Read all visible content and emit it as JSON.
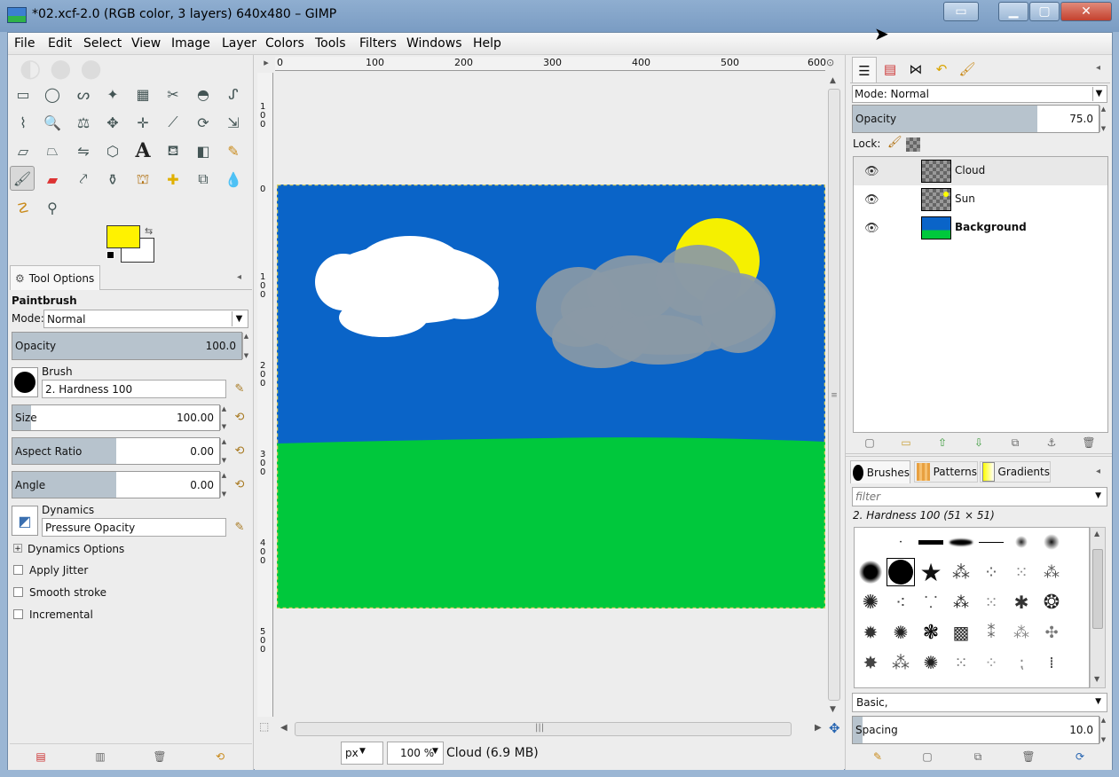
{
  "window": {
    "title": "*02.xcf-2.0 (RGB color, 3 layers) 640x480 – GIMP",
    "minimize_icon": "minimize-icon",
    "maximize_icon": "maximize-icon",
    "close_icon": "close-icon"
  },
  "menu": [
    "File",
    "Edit",
    "Select",
    "View",
    "Image",
    "Layer",
    "Colors",
    "Tools",
    "Filters",
    "Windows",
    "Help"
  ],
  "toolbox": {
    "colors": {
      "foreground": "#fff200",
      "background": "#ffffff"
    }
  },
  "tool_options": {
    "tab_label": "Tool Options",
    "tool_name": "Paintbrush",
    "mode_label": "Mode:",
    "mode_value": "Normal",
    "opacity_label": "Opacity",
    "opacity_value": "100.0",
    "brush_label": "Brush",
    "brush_value": "2. Hardness 100",
    "size_label": "Size",
    "size_value": "100.00",
    "aspect_label": "Aspect Ratio",
    "aspect_value": "0.00",
    "angle_label": "Angle",
    "angle_value": "0.00",
    "dynamics_label": "Dynamics",
    "dynamics_value": "Pressure Opacity",
    "dynamics_options_label": "Dynamics Options",
    "apply_jitter_label": "Apply Jitter",
    "smooth_stroke_label": "Smooth stroke",
    "incremental_label": "Incremental"
  },
  "canvas": {
    "ruler_top_labels": [
      "0",
      "100",
      "200",
      "300",
      "400",
      "500",
      "600"
    ],
    "ruler_left_labels": [
      "100",
      "0",
      "100",
      "200",
      "300",
      "400",
      "500"
    ],
    "sky_color": "#0a64c8",
    "grass_color": "#00c83c",
    "unit_value": "px",
    "zoom_value": "100 %",
    "status_text": "Cloud (6.9 MB)"
  },
  "layers_panel": {
    "mode_label": "Mode: Normal",
    "opacity_label": "Opacity",
    "opacity_value": "75.0",
    "lock_label": "Lock:",
    "layers": [
      {
        "name": "Cloud",
        "visible": true,
        "selected": true
      },
      {
        "name": "Sun",
        "visible": true,
        "selected": false
      },
      {
        "name": "Background",
        "visible": true,
        "selected": false
      }
    ]
  },
  "brushes_panel": {
    "tabs": [
      "Brushes",
      "Patterns",
      "Gradients"
    ],
    "filter_placeholder": "filter",
    "selected_brush": "2. Hardness 100 (51 × 51)",
    "tag_value": "Basic,",
    "spacing_label": "Spacing",
    "spacing_value": "10.0"
  }
}
